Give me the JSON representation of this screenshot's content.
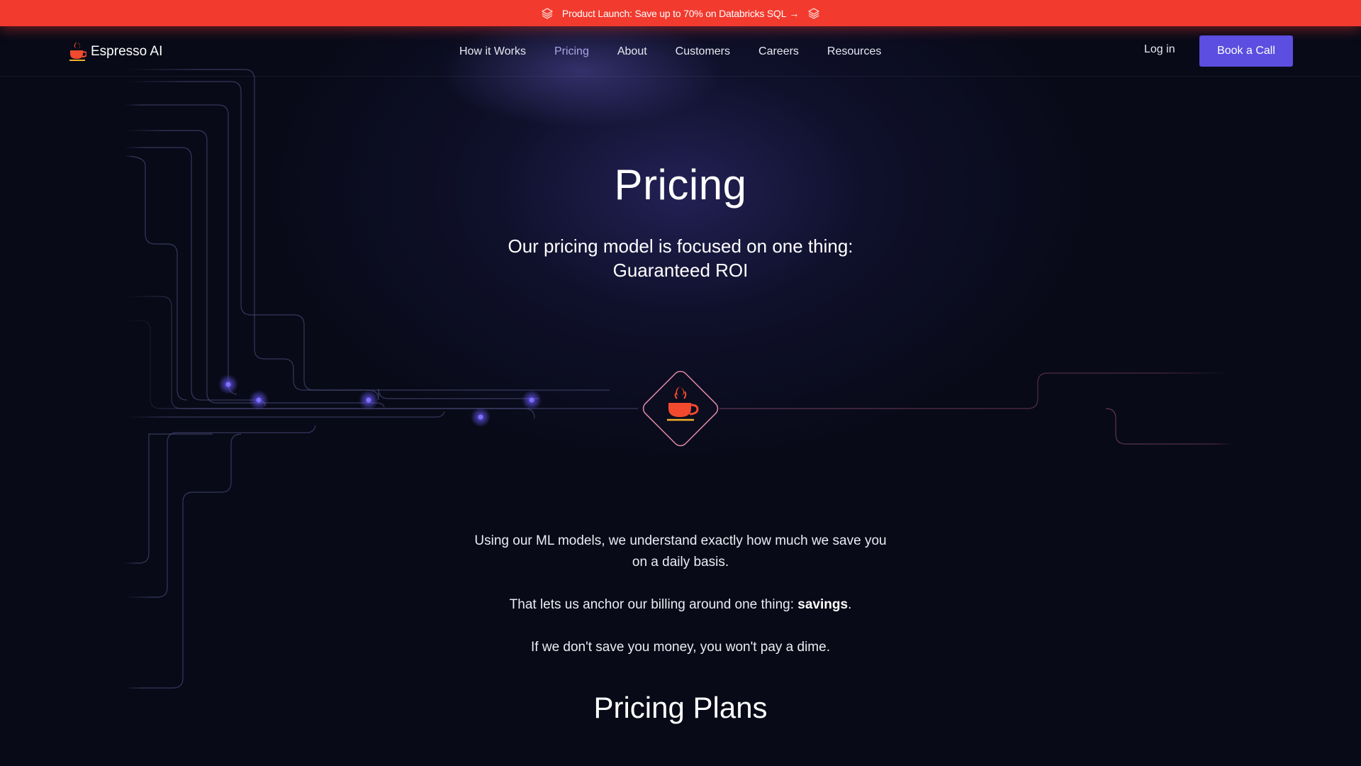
{
  "banner": {
    "text": "Product Launch: Save up to 70% on Databricks SQL",
    "arrow": "→",
    "icon": "layers-icon"
  },
  "nav": {
    "logo_text": "Espresso AI",
    "links": [
      {
        "label": "How it Works"
      },
      {
        "label": "Pricing"
      },
      {
        "label": "About"
      },
      {
        "label": "Customers"
      },
      {
        "label": "Careers"
      },
      {
        "label": "Resources"
      }
    ],
    "login_label": "Log in",
    "cta_label": "Book a Call"
  },
  "hero": {
    "title": "Pricing",
    "subtitle_line1": "Our pricing model is focused on one thing:",
    "subtitle_line2": "Guaranteed ROI",
    "center_icon": "coffee-cup-icon"
  },
  "body": {
    "paragraph1": "Using our ML models, we understand exactly how much we save you on a daily basis.",
    "paragraph2_prefix": "That lets us anchor our billing around one thing: ",
    "paragraph2_bold": "savings",
    "paragraph2_suffix": ".",
    "paragraph3": "If we don't save you money, you won't pay a dime."
  },
  "plans": {
    "title": "Pricing Plans"
  },
  "colors": {
    "background": "#080a17",
    "banner": "#f23a2e",
    "accent": "#5b4ee0",
    "nav_active": "#a8a6e8"
  }
}
